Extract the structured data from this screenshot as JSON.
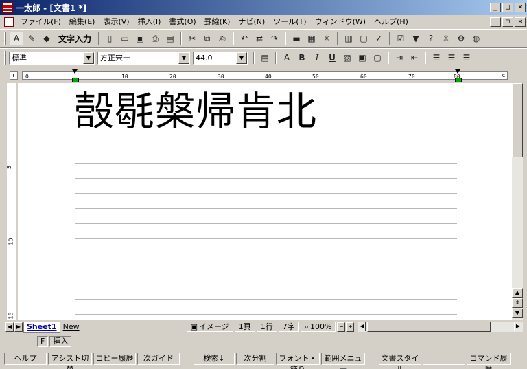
{
  "window": {
    "title": "一太郎 - [文書1 *]"
  },
  "menu": [
    "ファイル(F)",
    "編集(E)",
    "表示(V)",
    "挿入(I)",
    "書式(O)",
    "罫線(K)",
    "ナビ(N)",
    "ツール(T)",
    "ウィンドウ(W)",
    "ヘルプ(H)"
  ],
  "toolbar1": {
    "mode_label": "文字入力"
  },
  "toolbar2": {
    "style": "標準",
    "font": "方正宋一",
    "size": "44.0"
  },
  "ruler": {
    "marks": [
      "0",
      "10",
      "20",
      "30",
      "40",
      "50",
      "60",
      "70",
      "80"
    ],
    "vmarks": [
      "5",
      "10",
      "15"
    ]
  },
  "document": {
    "text": "嗀毼槃帰肯北"
  },
  "tabs": {
    "active": "Sheet1",
    "new": "New"
  },
  "status": {
    "image": "イメージ",
    "page": "1頁",
    "line": "1行",
    "col": "7字",
    "zoom": "100%"
  },
  "mode": {
    "key": "F",
    "insert": "挿入"
  },
  "fkeys": [
    "ヘルプ",
    "アシスト切替",
    "コピー履歴",
    "次ガイド",
    "検索↓",
    "次分割",
    "フォント・飾り",
    "範囲メニュー",
    "文書スタイル",
    "",
    "コマンド履歴"
  ]
}
